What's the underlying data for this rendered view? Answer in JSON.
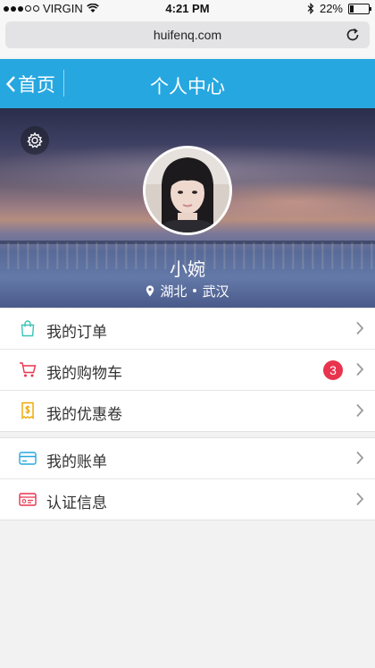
{
  "status_bar": {
    "carrier": "VIRGIN",
    "time": "4:21 PM",
    "battery_percent": "22%",
    "battery_level": 0.22,
    "wifi_icon": "wifi-icon",
    "bluetooth_icon": "bluetooth-icon"
  },
  "browser": {
    "url": "huifenq.com",
    "reload_icon": "reload-icon"
  },
  "navbar": {
    "back_label": "首页",
    "title": "个人中心",
    "background_color": "#27a7e0"
  },
  "profile": {
    "name": "小婉",
    "location_province": "湖北",
    "location_separator": "•",
    "location_city": "武汉",
    "settings_icon": "gear-icon"
  },
  "menu_group_1": [
    {
      "label": "我的订单",
      "icon": "shopping-bag-icon",
      "icon_color": "#3cc3b6"
    },
    {
      "label": "我的购物车",
      "icon": "shopping-cart-icon",
      "icon_color": "#e8344e",
      "badge": "3"
    },
    {
      "label": "我的优惠卷",
      "icon": "coupon-icon",
      "icon_color": "#f0a500"
    }
  ],
  "menu_group_2": [
    {
      "label": "我的账单",
      "icon": "wallet-card-icon",
      "icon_color": "#27a7e0"
    },
    {
      "label": "认证信息",
      "icon": "id-card-icon",
      "icon_color": "#e8344e"
    }
  ],
  "colors": {
    "accent": "#27a7e0",
    "badge": "#e8344e"
  }
}
